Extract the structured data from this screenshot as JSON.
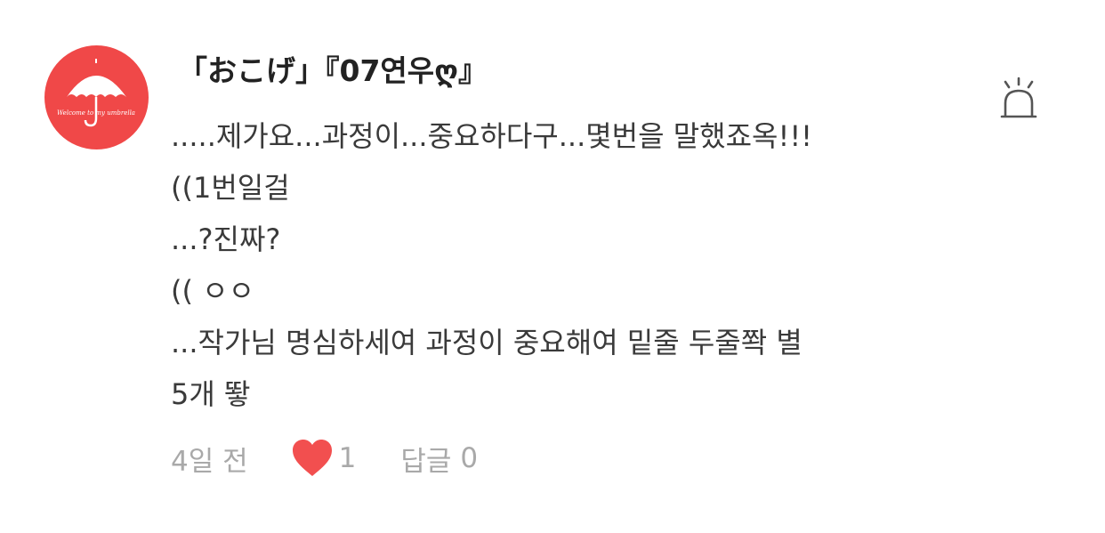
{
  "comment": {
    "username": "「おこげ」『07연우ღ』",
    "avatar_text": "Welcome to my umbrella",
    "lines": [
      ".....제가요...과정이...중요하다구...몇번을 말했죠옥!!!",
      "((1번일걸",
      "...?진짜?",
      "(( ㅇㅇ",
      "...작가님 명심하세여 과정이 중요해여 밑줄 두줄쫙 별",
      "5개 뙇"
    ],
    "timestamp": "4일 전",
    "like_count": "1",
    "reply_label": "답글",
    "reply_count": "0"
  },
  "colors": {
    "avatar_bg": "#f04848",
    "heart": "#f24f4f",
    "meta_text": "#a9a9a9",
    "body_text": "#3a3a3a"
  },
  "icons": {
    "report": "siren-icon",
    "like": "heart-icon"
  }
}
